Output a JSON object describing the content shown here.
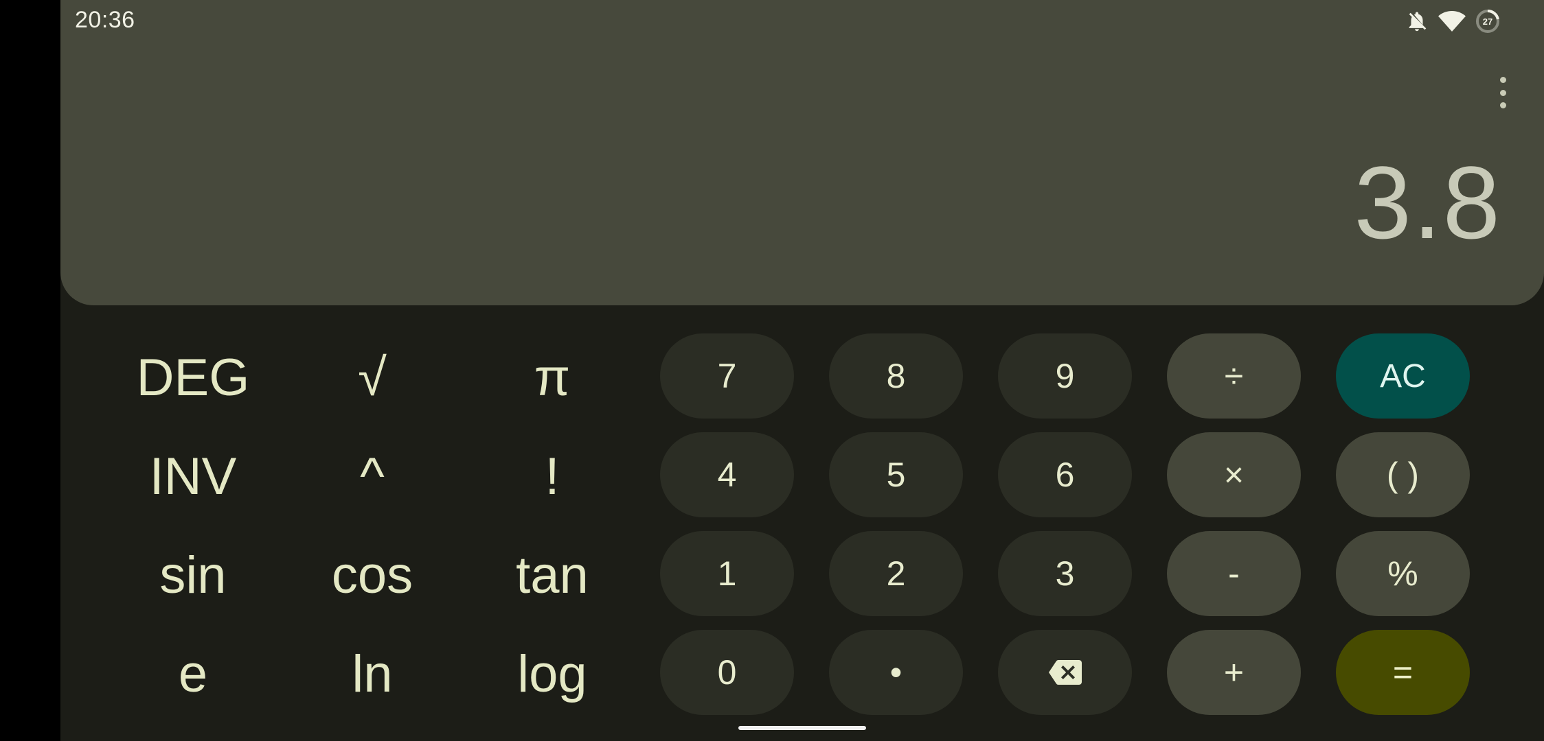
{
  "status_bar": {
    "time": "20:36",
    "battery_level": "27",
    "icons": [
      "notifications-off-icon",
      "wifi-icon",
      "battery-icon"
    ]
  },
  "display": {
    "result": "3.8",
    "menu_icon": "more-vert-icon"
  },
  "scientific_keys": {
    "deg": "DEG",
    "sqrt": "√",
    "pi": "π",
    "inv": "INV",
    "power": "^",
    "factorial": "!",
    "sin": "sin",
    "cos": "cos",
    "tan": "tan",
    "e": "e",
    "ln": "ln",
    "log": "log"
  },
  "number_keys": {
    "seven": "7",
    "eight": "8",
    "nine": "9",
    "four": "4",
    "five": "5",
    "six": "6",
    "one": "1",
    "two": "2",
    "three": "3",
    "zero": "0",
    "decimal": "•"
  },
  "operator_keys": {
    "divide": "÷",
    "multiply": "×",
    "minus": "-",
    "plus": "+",
    "clear": "AC",
    "parentheses": "( )",
    "percent": "%",
    "equals": "=",
    "backspace_icon": "backspace-icon"
  },
  "colors": {
    "background": "#1c1d17",
    "display": "#47493c",
    "number_key": "#2b2d24",
    "operator_key": "#45473a",
    "clear_key": "#02504a",
    "equals_key": "#474b00",
    "key_text": "#e4e8c4"
  }
}
